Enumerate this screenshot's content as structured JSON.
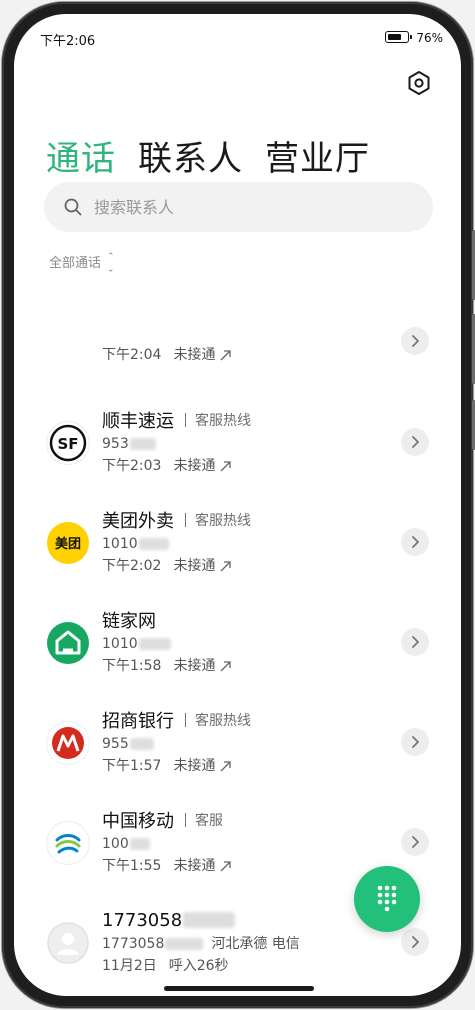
{
  "status_bar": {
    "time": "下午2:06",
    "battery_percent_label": "76%",
    "battery_level": 0.76
  },
  "header": {
    "settings_icon": "settings-hexagon-icon",
    "tabs": [
      {
        "label": "通话",
        "active": true
      },
      {
        "label": "联系人",
        "active": false
      },
      {
        "label": "营业厅",
        "active": false
      }
    ]
  },
  "search": {
    "placeholder": "搜索联系人",
    "icon": "search-icon"
  },
  "filter": {
    "label": "全部通话"
  },
  "calls": [
    {
      "name": "",
      "tag": "",
      "number": "",
      "time": "下午2:04",
      "status": "未接通"
    },
    {
      "name": "顺丰速运",
      "tag": "客服热线",
      "number": "953",
      "time": "下午2:03",
      "status": "未接通",
      "avatar": "sf-express-logo"
    },
    {
      "name": "美团外卖",
      "tag": "客服热线",
      "number": "1010",
      "time": "下午2:02",
      "status": "未接通",
      "avatar": "meituan-logo",
      "avatar_text": "美团"
    },
    {
      "name": "链家网",
      "tag": "",
      "number": "1010",
      "time": "下午1:58",
      "status": "未接通",
      "avatar": "lianjia-logo"
    },
    {
      "name": "招商银行",
      "tag": "客服热线",
      "number": "955",
      "time": "下午1:57",
      "status": "未接通",
      "avatar": "cmb-logo"
    },
    {
      "name": "中国移动",
      "tag": "客服",
      "number": "100",
      "time": "下午1:55",
      "status": "未接通",
      "avatar": "china-mobile-logo"
    },
    {
      "name": "1773058",
      "tag": "",
      "number": "1773058",
      "location": "河北承德 电信",
      "time": "11月2日",
      "status": "呼入26秒",
      "avatar": "default-person-avatar"
    }
  ],
  "fab": {
    "icon": "dialpad-icon"
  },
  "colors": {
    "accent": "#2db57c",
    "fab": "#22c07a",
    "meituan_yellow": "#ffd100",
    "lianjia_green": "#16a861",
    "cmb_red": "#d52b1e"
  }
}
